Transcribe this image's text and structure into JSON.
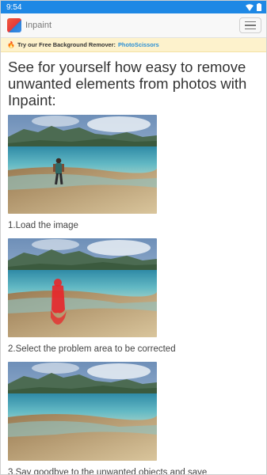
{
  "status_bar": {
    "time": "9:54"
  },
  "navbar": {
    "brand": "Inpaint"
  },
  "promo": {
    "text": "Try our Free Background Remover:",
    "link": "PhotoScissors"
  },
  "main": {
    "heading": "See for yourself how easy to remove unwanted elements from photos with Inpaint:",
    "steps": [
      {
        "caption": "1.Load the image"
      },
      {
        "caption": "2.Select the problem area to be corrected"
      },
      {
        "caption": "3.Say goodbye to the unwanted objects and save"
      }
    ]
  },
  "colors": {
    "status_bar": "#1e88e5",
    "promo_bg": "#fdf2cc",
    "link": "#2a8fd6",
    "selection": "#e8262a"
  },
  "icons": [
    "wifi-icon",
    "battery-icon",
    "hamburger-icon",
    "flame-icon"
  ]
}
